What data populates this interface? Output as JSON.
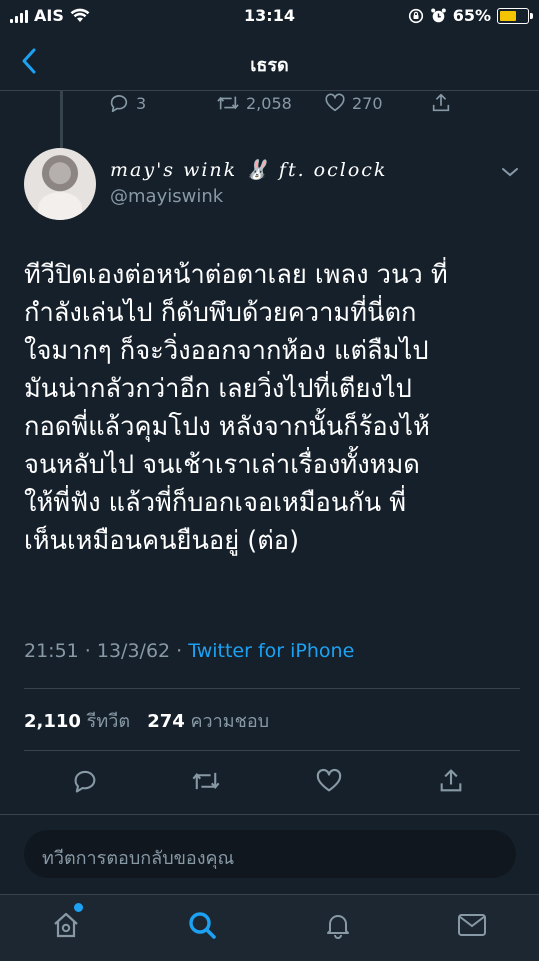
{
  "status_bar": {
    "carrier": "AIS",
    "time": "13:14",
    "battery": "65%"
  },
  "nav": {
    "title": "เธรด"
  },
  "previous_tweet": {
    "replies": "3",
    "retweets": "2,058",
    "likes": "270"
  },
  "tweet": {
    "display_name": "may's wink 🐰 ft. oclock",
    "handle": "@mayiswink",
    "lines": [
      "ทีวีปิดเองต่อหน้าต่อตาเลย เพลง วนว ที่",
      "กำลังเล่นไป ก็ดับพึบด้วยความที่นี่ตก",
      "ใจมากๆ ก็จะวิ่งออกจากห้อง แต่ลืมไป",
      "มันน่ากลัวกว่าอีก เลยวิ่งไปที่เตียงไป",
      "กอดพี่แล้วคุมโปง หลังจากนั้นก็ร้องไห้",
      "จนหลับไป จนเช้าเราเล่าเรื่องทั้งหมด",
      "ให้พี่ฟัง แล้วพี่ก็บอกเจอเหมือนกัน พี่",
      "เห็นเหมือนคนยืนอยู่ (ต่อ)"
    ],
    "time": "21:51 · 13/3/62 · ",
    "source": "Twitter for iPhone",
    "retweet_count": "2,110",
    "retweet_label": "รีทวีต",
    "like_count": "274",
    "like_label": "ความชอบ"
  },
  "reply": {
    "placeholder": "ทวีตการตอบกลับของคุณ"
  },
  "colors": {
    "background": "#15202b",
    "accent": "#1da1f2",
    "muted": "#8899a6",
    "battery": "#f5c400"
  },
  "icons": [
    "back-chevron-icon",
    "reply-icon",
    "retweet-icon",
    "like-icon",
    "share-icon",
    "more-chevron-icon",
    "home-icon",
    "search-icon",
    "notifications-icon",
    "messages-icon"
  ]
}
